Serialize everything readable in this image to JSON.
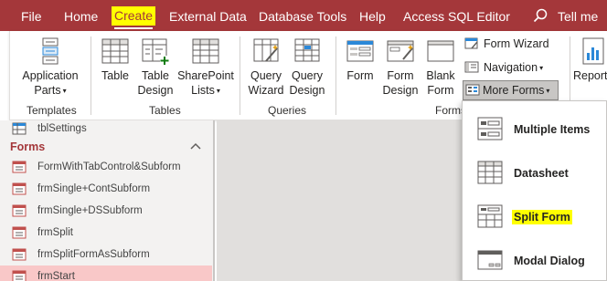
{
  "menu": {
    "tabs": [
      "File",
      "Home",
      "Create",
      "External Data",
      "Database Tools",
      "Help",
      "Access SQL Editor",
      "Tell me"
    ],
    "active_tab": "Create",
    "brand_color": "#a4373a",
    "highlight_color": "#ffff00"
  },
  "ribbon": {
    "templates": {
      "application_parts_line1": "Application",
      "application_parts_line2": "Parts",
      "group_label": "Templates"
    },
    "tables": {
      "table": "Table",
      "table_design_line1": "Table",
      "table_design_line2": "Design",
      "sharepoint_line1": "SharePoint",
      "sharepoint_line2": "Lists",
      "group_label": "Tables"
    },
    "queries": {
      "wizard_line1": "Query",
      "wizard_line2": "Wizard",
      "design_line1": "Query",
      "design_line2": "Design",
      "group_label": "Queries"
    },
    "forms": {
      "form": "Form",
      "form_design_line1": "Form",
      "form_design_line2": "Design",
      "blank_line1": "Blank",
      "blank_line2": "Form",
      "form_wizard": "Form Wizard",
      "navigation": "Navigation",
      "more_forms": "More Forms",
      "group_label": "Forms"
    },
    "reports": {
      "report": "Report"
    }
  },
  "nav": {
    "top_item": "tblSettings",
    "group": "Forms",
    "items": [
      "FormWithTabControl&Subform",
      "frmSingle+ContSubform",
      "frmSingle+DSSubform",
      "frmSplit",
      "frmSplitFormAsSubform",
      "frmStart"
    ],
    "selected": "frmStart"
  },
  "more_forms_menu": {
    "items": [
      "Multiple Items",
      "Datasheet",
      "Split Form",
      "Modal Dialog"
    ],
    "highlighted": "Split Form"
  }
}
